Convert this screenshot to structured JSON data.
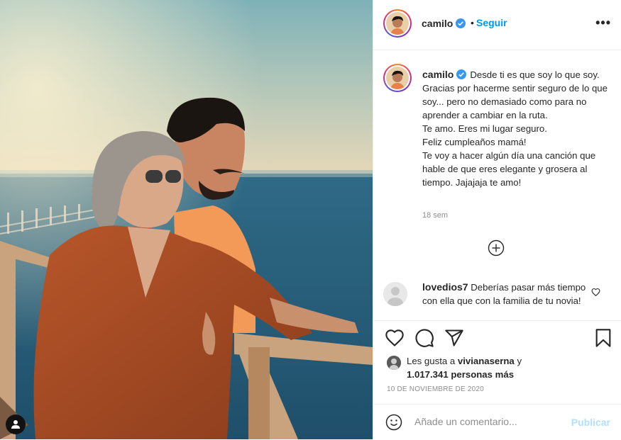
{
  "post": {
    "username": "camilo",
    "follow_label": "Seguir",
    "separator": "•",
    "more_label": "•••"
  },
  "caption": {
    "username": "camilo",
    "lines": [
      "Desde ti es que soy lo que soy.",
      "Gracias por hacerme sentir seguro de lo que soy... pero no demasiado como para no aprender a cambiar en la ruta.",
      "Te amo. Eres mi lugar seguro.",
      "Feliz cumpleaños mamá!",
      "Te voy a hacer algún día una canción que hable de que eres elegante y grosera al tiempo. Jajajaja te amo!"
    ],
    "time": "18 sem"
  },
  "comment": {
    "username": "lovedios7",
    "text": "Deberías pasar más tiempo con ella que con la familia de tu novia!"
  },
  "likes": {
    "prefix": "Les gusta a",
    "user": "vivianaserna",
    "conj": "y",
    "count": "1.017.341 personas más"
  },
  "date": "10 DE NOVIEMBRE DE 2020",
  "add_comment": {
    "placeholder": "Añade un comentario...",
    "publish_label": "Publicar"
  },
  "colors": {
    "link": "#0095f6",
    "publish_disabled": "#b2dffc",
    "muted": "#8e8e8e",
    "text": "#262626"
  },
  "icons": [
    "user-tag-icon",
    "verified-icon",
    "more-options-icon",
    "load-more-icon",
    "heart-icon",
    "comment-icon",
    "share-icon",
    "save-icon",
    "emoji-icon"
  ]
}
